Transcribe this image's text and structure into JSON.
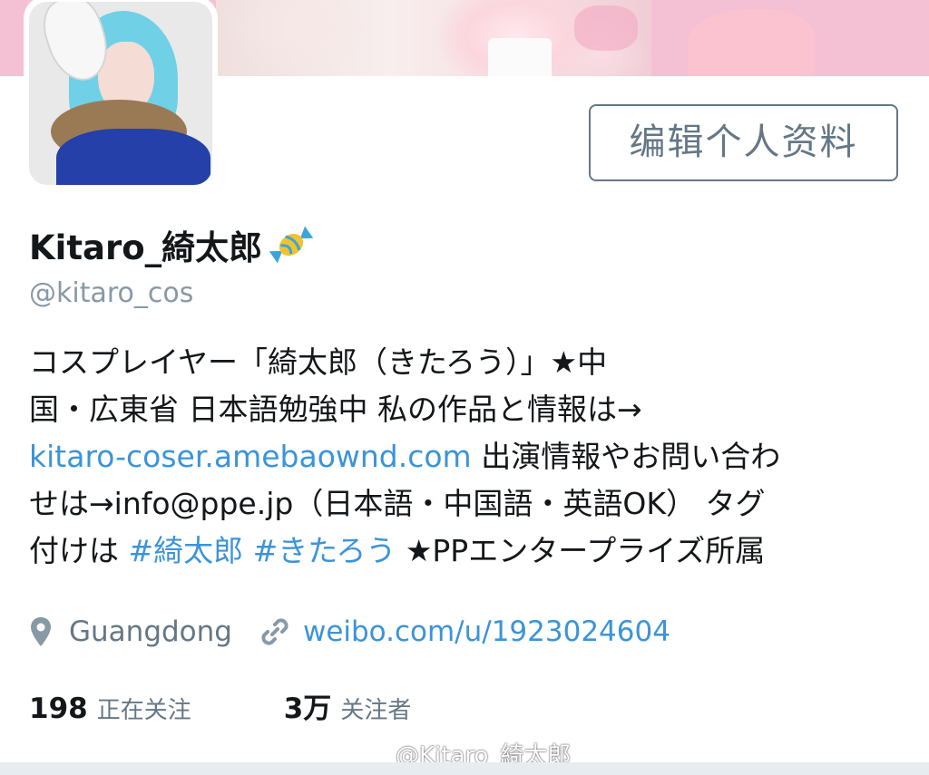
{
  "profile": {
    "edit_button": "编辑个人资料",
    "display_name": "Kitaro_綺太郎",
    "handle": "@kitaro_cos",
    "bio": {
      "line1": "コスプレイヤー「綺太郎（きたろう）」★中",
      "line2": "国・広東省 日本語勉強中 私の作品と情報は→",
      "line3_link": "kitaro-coser.amebaownd.com",
      "line3_text": " 出演情報やお問い合わ",
      "line4": "せは→info@ppe.jp（日本語・中国語・英語OK） タグ",
      "line5_prefix": "付けは ",
      "hashtag1": "#綺太郎",
      "hashtag2": "#きたろう",
      "line5_suffix": " ★PPエンタープライズ所属"
    },
    "location": "Guangdong",
    "website": "weibo.com/u/1923024604",
    "following_count": "198",
    "following_label": "正在关注",
    "followers_count": "3万",
    "followers_label": "关注者"
  },
  "watermark": "@Kitaro_綺太郎",
  "icons": {
    "location": "map-pin-icon",
    "link": "link-icon",
    "name_emoji": "candy-icon",
    "watermark": "weibo-icon"
  },
  "colors": {
    "link": "#3b94d9",
    "secondary_text": "#657786",
    "banner": "#f4c0d4"
  }
}
